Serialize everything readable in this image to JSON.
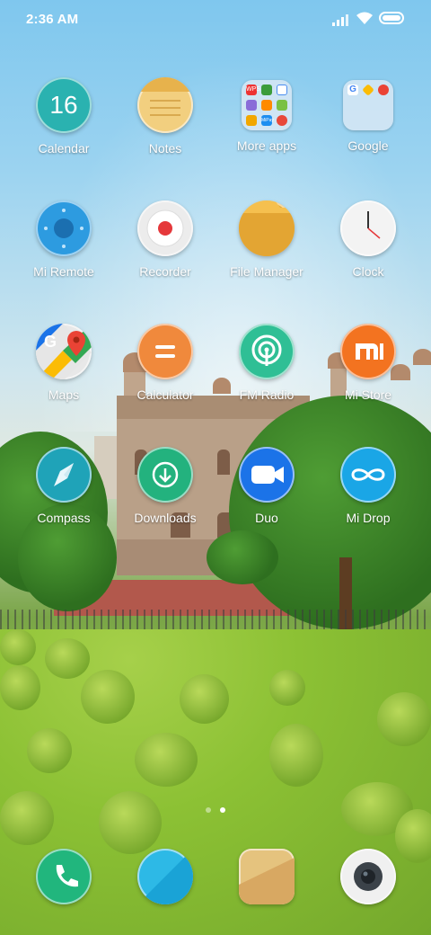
{
  "status_bar": {
    "time": "2:36 AM"
  },
  "apps": [
    {
      "label": "Calendar",
      "icon": "calendar-icon",
      "day": "16",
      "color": "#2ab2b0"
    },
    {
      "label": "Notes",
      "icon": "notes-icon",
      "color": "#f2c86a"
    },
    {
      "label": "More apps",
      "icon": "folder-icon"
    },
    {
      "label": "Google",
      "icon": "folder-icon"
    },
    {
      "label": "Mi Remote",
      "icon": "remote-icon",
      "color": "#2d9be0"
    },
    {
      "label": "Recorder",
      "icon": "record-icon",
      "color": "#e8e8e8"
    },
    {
      "label": "File Manager",
      "icon": "folder-file-icon",
      "color": "#f0b63a"
    },
    {
      "label": "Clock",
      "icon": "clock-icon",
      "color": "#f3f3f3"
    },
    {
      "label": "Maps",
      "icon": "maps-icon"
    },
    {
      "label": "Calculator",
      "icon": "calculator-icon",
      "color": "#f0893c"
    },
    {
      "label": "FM Radio",
      "icon": "radio-icon",
      "color": "#2fbf95"
    },
    {
      "label": "Mi Store",
      "icon": "mi-store-icon",
      "color": "#f37320"
    },
    {
      "label": "Compass",
      "icon": "compass-icon",
      "color": "#1fa3b8"
    },
    {
      "label": "Downloads",
      "icon": "download-icon",
      "color": "#23b27e"
    },
    {
      "label": "Duo",
      "icon": "duo-icon",
      "color": "#1b73e8"
    },
    {
      "label": "Mi Drop",
      "icon": "mi-drop-icon",
      "color": "#1aa6e6"
    }
  ],
  "folder_more_apps_badges": [
    "WPS",
    "",
    "",
    "",
    "",
    "",
    "MiPay",
    "",
    ""
  ],
  "dock": [
    {
      "icon": "phone-icon",
      "color": "#21b67d"
    },
    {
      "icon": "messages-icon",
      "color": "#2db9e6"
    },
    {
      "icon": "gallery-icon",
      "color": "#e5c37e"
    },
    {
      "icon": "camera-icon",
      "color": "#f0f0f0"
    }
  ]
}
